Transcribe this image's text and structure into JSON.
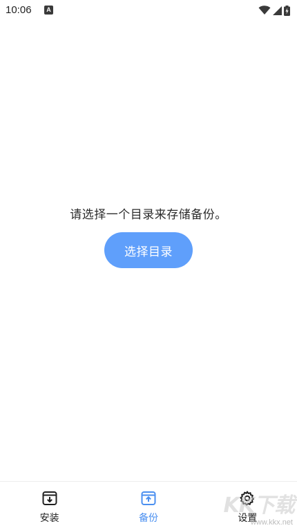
{
  "status_bar": {
    "time": "10:06",
    "app_icon_letter": "A"
  },
  "main": {
    "prompt": "请选择一个目录来存储备份。",
    "select_button_label": "选择目录"
  },
  "bottom_nav": {
    "items": [
      {
        "label": "安装",
        "icon": "install-icon",
        "active": false
      },
      {
        "label": "备份",
        "icon": "backup-icon",
        "active": true
      },
      {
        "label": "设置",
        "icon": "gear-icon",
        "active": false
      }
    ]
  },
  "watermark": {
    "main": "KK下载",
    "sub": "www.kkx.net"
  },
  "colors": {
    "accent": "#5f9ffb",
    "active_nav": "#4a8ff0",
    "text": "#1f1f1f"
  }
}
